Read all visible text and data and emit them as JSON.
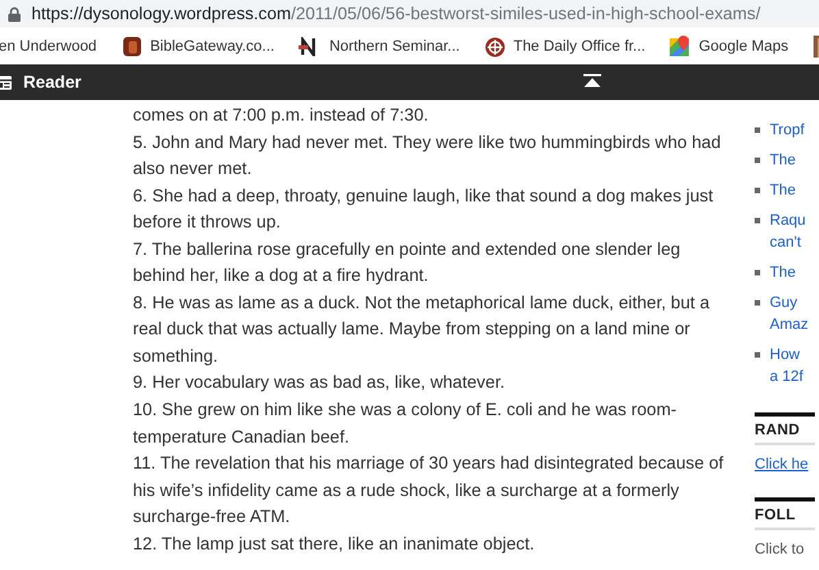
{
  "address_bar": {
    "domain": "https://dysonology.wordpress.com",
    "path": "/2011/05/06/56-bestworst-similes-used-in-high-school-exams/"
  },
  "bookmarks": [
    {
      "label": "en Underwood",
      "kind": "none"
    },
    {
      "label": "BibleGateway.co...",
      "kind": "book"
    },
    {
      "label": "Northern Seminar...",
      "kind": "letter"
    },
    {
      "label": "The Daily Office fr...",
      "kind": "emblem"
    },
    {
      "label": "Google Maps",
      "kind": "map"
    },
    {
      "kind": "picture"
    }
  ],
  "reader_bar": {
    "title": "Reader"
  },
  "article": {
    "paragraphs": [
      "comes on at 7:00 p.m. instead of 7:30.",
      "5. John and Mary had never met. They were like two hummingbirds who had also never met.",
      "6. She had a deep, throaty, genuine laugh, like that sound a dog makes just before it throws up.",
      "7. The ballerina rose gracefully en pointe and extended one slender leg behind her, like a dog at a fire hydrant.",
      "8. He was as lame as a duck. Not the metaphorical lame duck, either, but a real duck that was actually lame. Maybe from stepping on a land mine or something.",
      "9. Her vocabulary was as bad as, like, whatever.",
      "10. She grew on him like she was a colony of E. coli and he was room-temperature Canadian beef.",
      "11. The revelation that his marriage of 30 years had disintegrated because of his wife’s infidelity came as a rude shock, like a surcharge at a formerly surcharge-free ATM.",
      "12. The lamp just sat there, like an inanimate object."
    ]
  },
  "sidebar": {
    "links": [
      [
        "Tropf"
      ],
      [
        "The"
      ],
      [
        "The"
      ],
      [
        "Raqu",
        "can't"
      ],
      [
        "The"
      ],
      [
        "Guy",
        "Amaz"
      ],
      [
        "How",
        "a 12f"
      ]
    ],
    "widgets": [
      {
        "heading": "RAND",
        "kind": "link",
        "text": "Click he"
      },
      {
        "heading": "FOLL",
        "kind": "text",
        "text": "Click to"
      }
    ]
  }
}
